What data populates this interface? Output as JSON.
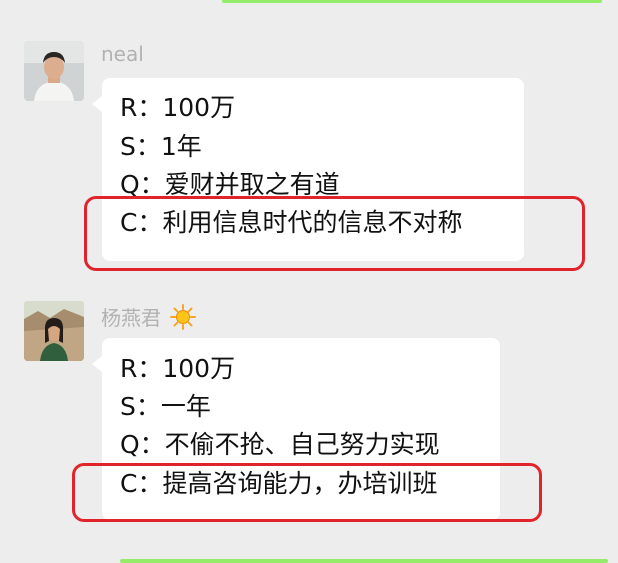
{
  "messages": [
    {
      "sender": "neal",
      "lines": [
        "R：100万",
        "S：1年",
        "Q：爱财并取之有道",
        "C：利用信息时代的信息不对称"
      ]
    },
    {
      "sender": "杨燕君",
      "sender_emoji": "sun-icon",
      "lines": [
        "R：100万",
        "S：一年",
        "Q：不偷不抢、自己努力实现",
        "C：提高咨询能力，办培训班"
      ]
    }
  ],
  "colors": {
    "background": "#ededed",
    "bubble": "#ffffff",
    "sender_name": "#b2b2b2",
    "highlight": "#e1242b",
    "outgoing_bubble": "#95ec69"
  }
}
